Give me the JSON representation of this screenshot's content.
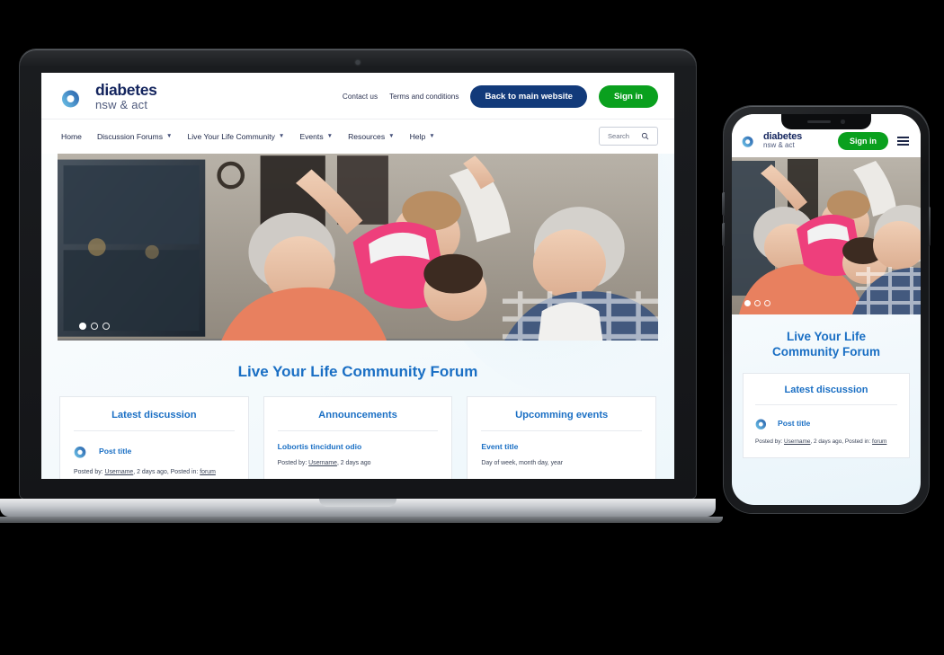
{
  "site": {
    "brand": {
      "name": "diabetes",
      "sub": "nsw & act",
      "logo_icon": "diabetes-d-logo"
    },
    "topbar": {
      "links": [
        {
          "label": "Contact us"
        },
        {
          "label": "Terms and conditions"
        }
      ],
      "main_website_button": "Back to main website",
      "signin_button": "Sign in",
      "main_website_color": "#123a7a",
      "signin_color": "#0aa01e"
    },
    "nav": {
      "items": [
        {
          "label": "Home",
          "has_dropdown": false
        },
        {
          "label": "Discussion Forums",
          "has_dropdown": true
        },
        {
          "label": "Live Your Life Community",
          "has_dropdown": true
        },
        {
          "label": "Events",
          "has_dropdown": true
        },
        {
          "label": "Resources",
          "has_dropdown": true
        },
        {
          "label": "Help",
          "has_dropdown": true
        }
      ],
      "search_placeholder": "Search",
      "search_icon": "magnifier-icon"
    },
    "hero": {
      "alt": "Grandparents and grandchildren laughing together outdoors",
      "carousel_dots": 3,
      "active_dot": 1
    },
    "section_title": "Live Your Life Community Forum",
    "section_title_color": "#1a6fc4",
    "cards": [
      {
        "heading": "Latest discussion",
        "has_avatar": true,
        "item_title": "Post title",
        "meta_prefix": "Posted by: ",
        "meta_user": "Username",
        "meta_mid": ", 2 days ago, Posted in: ",
        "meta_link": "forum"
      },
      {
        "heading": "Announcements",
        "has_avatar": false,
        "item_title": "Lobortis tincidunt odio",
        "meta_prefix": "Posted by: ",
        "meta_user": "Username",
        "meta_mid": ", 2 days ago",
        "meta_link": ""
      },
      {
        "heading": "Upcomming events",
        "has_avatar": false,
        "item_title": "Event title",
        "meta_prefix": "Day of week, month day, year",
        "meta_user": "",
        "meta_mid": "",
        "meta_link": ""
      }
    ]
  },
  "mobile": {
    "signin_button": "Sign in",
    "menu_icon": "hamburger-menu-icon",
    "section_title": "Live Your Life Community Forum",
    "card": {
      "heading": "Latest discussion",
      "item_title": "Post title",
      "meta_prefix": "Posted by: ",
      "meta_user": "Username",
      "meta_mid": ", 2 days ago, Posted in: ",
      "meta_link": "forum"
    },
    "carousel_dots": 3,
    "active_dot": 1
  },
  "background_color": "#000000"
}
